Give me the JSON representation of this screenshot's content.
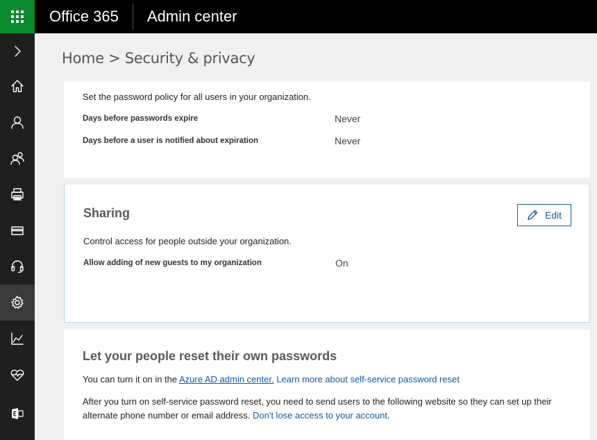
{
  "header": {
    "brand": "Office 365",
    "app_name": "Admin center"
  },
  "sidebar": {
    "items": [
      {
        "icon": "chevron-right-icon",
        "label": "Expand"
      },
      {
        "icon": "home-icon",
        "label": "Home"
      },
      {
        "icon": "user-icon",
        "label": "Users"
      },
      {
        "icon": "groups-icon",
        "label": "Groups"
      },
      {
        "icon": "printer-icon",
        "label": "Resources"
      },
      {
        "icon": "billing-icon",
        "label": "Billing"
      },
      {
        "icon": "headset-icon",
        "label": "Support"
      },
      {
        "icon": "gear-icon",
        "label": "Settings"
      },
      {
        "icon": "chart-icon",
        "label": "Reports"
      },
      {
        "icon": "health-icon",
        "label": "Health"
      },
      {
        "icon": "exchange-icon",
        "label": "Admin centers"
      }
    ],
    "active_index": 7
  },
  "breadcrumb": "Home > Security & privacy",
  "password_policy": {
    "description": "Set the password policy for all users in your organization.",
    "rows": [
      {
        "label": "Days before passwords expire",
        "value": "Never"
      },
      {
        "label": "Days before a user is notified about expiration",
        "value": "Never"
      }
    ]
  },
  "sharing": {
    "title": "Sharing",
    "edit_label": "Edit",
    "description": "Control access for people outside your organization.",
    "rows": [
      {
        "label": "Allow adding of new guests to my organization",
        "value": "On"
      }
    ]
  },
  "self_service": {
    "title": "Let your people reset their own passwords",
    "line1_prefix": "You can turn it on in the ",
    "line1_link": "Azure AD admin center.",
    "line1_link2": "Learn more about self-service password reset",
    "line2_text": "After you turn on self-service password reset, you need to send users to the following website so they can set up their alternate phone number or email address.",
    "line2_link": "Don't lose access to your account",
    "line2_suffix": "."
  },
  "colors": {
    "waffle_bg": "#0a8a2e",
    "topbar_bg": "#000000",
    "leftnav_bg": "#1f1f1f",
    "accent": "#1a5b8c",
    "link": "#0a5a9c"
  }
}
